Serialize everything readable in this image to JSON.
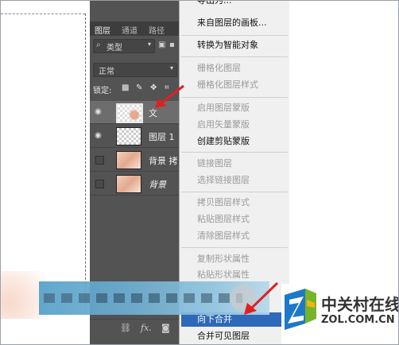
{
  "layers_panel": {
    "tabs": [
      "图层",
      "通道",
      "路径"
    ],
    "filter_kind": "类型",
    "blend_mode": "正常",
    "lock_label": "锁定:",
    "layers": [
      {
        "name": "文",
        "visible": true,
        "selected": true,
        "thumb": "selected-transparent"
      },
      {
        "name": "图层 1",
        "visible": true,
        "selected": false,
        "thumb": "transparent"
      },
      {
        "name": "背景 拷",
        "visible": false,
        "selected": false,
        "thumb": "photo"
      },
      {
        "name": "背景",
        "visible": false,
        "selected": false,
        "thumb": "photo"
      }
    ],
    "bottom_icons": [
      "link-icon",
      "fx-icon",
      "mask-icon"
    ],
    "bottom_fx_label": "fx."
  },
  "context_menu": {
    "items": [
      {
        "label": "导出为...",
        "enabled": true,
        "partial": true
      },
      {
        "label": "来自图层的画板...",
        "enabled": true
      },
      {
        "label": "转换为智能对象",
        "enabled": true
      },
      {
        "label": "栅格化图层",
        "enabled": false
      },
      {
        "label": "栅格化图层样式",
        "enabled": false
      },
      {
        "label": "启用图层蒙版",
        "enabled": false
      },
      {
        "label": "启用矢量蒙版",
        "enabled": false
      },
      {
        "label": "创建剪贴蒙版",
        "enabled": true
      },
      {
        "label": "链接图层",
        "enabled": false
      },
      {
        "label": "选择链接图层",
        "enabled": false
      },
      {
        "label": "拷贝图层样式",
        "enabled": false
      },
      {
        "label": "粘贴图层样式",
        "enabled": false
      },
      {
        "label": "清除图层样式",
        "enabled": false
      },
      {
        "label": "复制形状属性",
        "enabled": false
      },
      {
        "label": "粘贴形状属性",
        "enabled": false
      },
      {
        "label": "向下合并",
        "enabled": true,
        "highlighted": true
      },
      {
        "label": "合并可见图层",
        "enabled": true
      }
    ]
  },
  "watermark": {
    "brand_cn": "中关村在线",
    "brand_en": "ZOL.COM.CN"
  },
  "colors": {
    "panel_bg": "#535353",
    "menu_bg": "#f0f0f0",
    "highlight": "#2d69b8",
    "arrow_red": "#e02020",
    "logo_blue": "#1e78c8",
    "logo_yellow": "#f0b418",
    "logo_green": "#78b428"
  }
}
